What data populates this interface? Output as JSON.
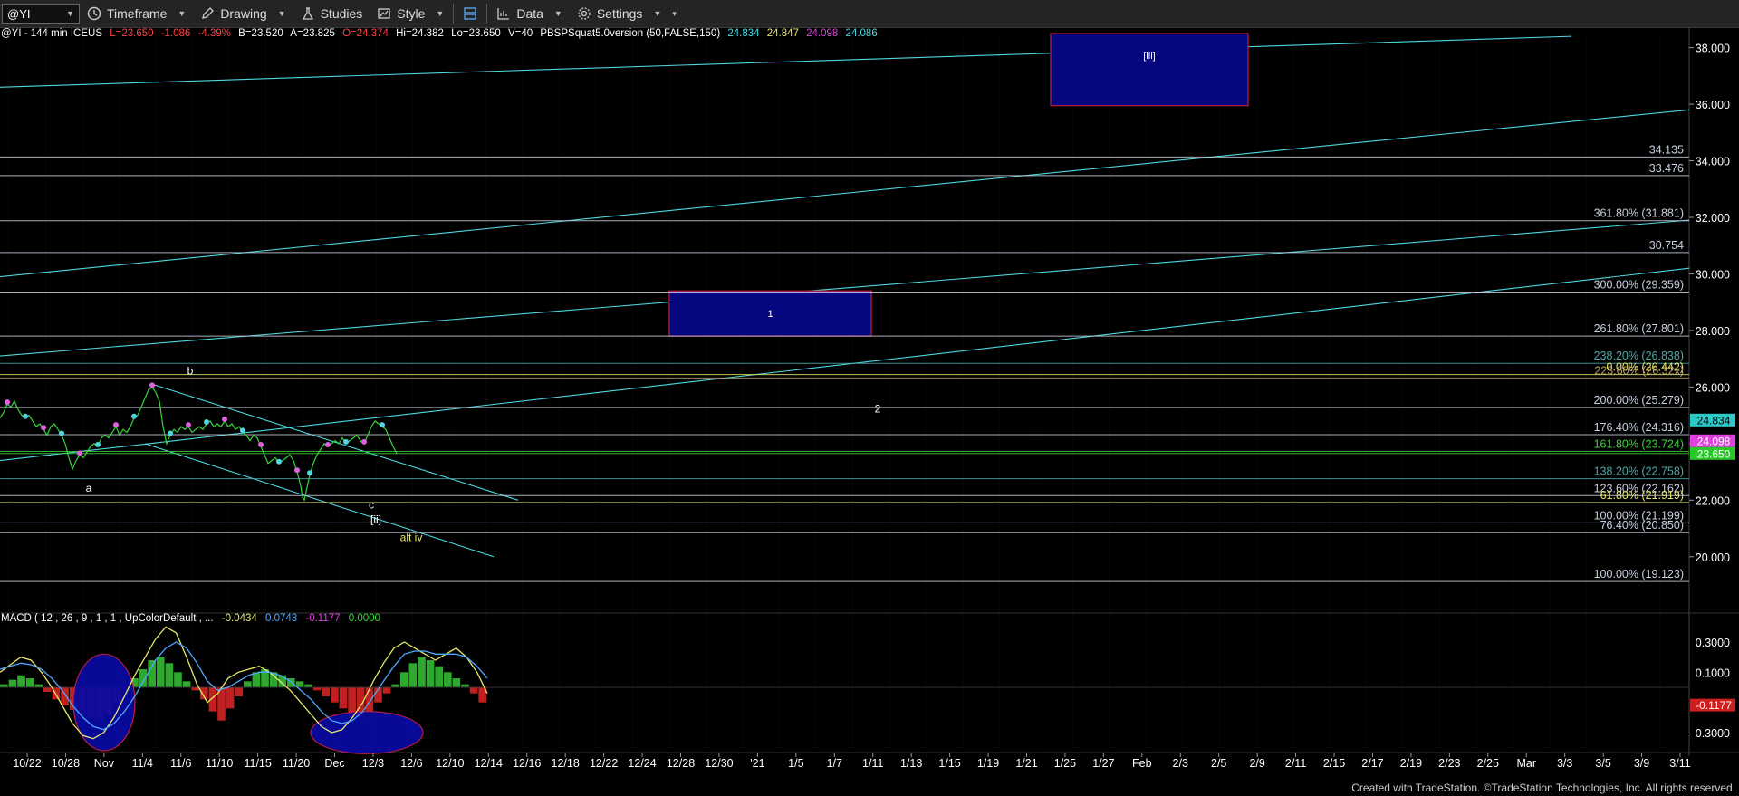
{
  "toolbar": {
    "symbol": "@YI",
    "timeframe": "Timeframe",
    "drawing": "Drawing",
    "studies": "Studies",
    "style": "Style",
    "data": "Data",
    "settings": "Settings"
  },
  "header": {
    "title": "@YI - 144 min  ICEUS",
    "last": "L=23.650",
    "change": "-1.086",
    "change_pct": "-4.39%",
    "bid": "B=23.520",
    "ask": "A=23.825",
    "open": "O=24.374",
    "high": "Hi=24.382",
    "low": "Lo=23.650",
    "volume": "V=40",
    "study": "PBSPSquat5.0version (50,FALSE,150)",
    "study_values": [
      "24.834",
      "24.847",
      "24.098",
      "24.086"
    ],
    "study_colors": [
      "#4fd7e0",
      "#e8e86a",
      "#e040e0",
      "#4fd7e0"
    ]
  },
  "macd_header": {
    "label": "MACD ( 12 , 26 , 9 , 1 , 1 , UpColorDefault , ...",
    "values": [
      "-0.0434",
      "0.0743",
      "-0.1177",
      "0.0000"
    ],
    "colors": [
      "#e8e86a",
      "#4fa8ff",
      "#e040e0",
      "#3ad43a"
    ]
  },
  "chart_data": {
    "type": "line",
    "title": "@YI - 144 min",
    "price_axis": {
      "ylim": [
        18.2,
        38.5
      ],
      "ticks": [
        "38.000",
        "36.000",
        "34.000",
        "32.000",
        "30.000",
        "28.000",
        "26.000",
        "24.000",
        "22.000",
        "20.000"
      ]
    },
    "macd_axis": {
      "ylim": [
        -0.42,
        0.42
      ],
      "ticks": [
        "0.3000",
        "0.1000",
        "-0.3000"
      ]
    },
    "x_labels": [
      "10/22",
      "10/28",
      "Nov",
      "11/4",
      "11/6",
      "11/10",
      "11/15",
      "11/20",
      "Dec",
      "12/3",
      "12/6",
      "12/10",
      "12/14",
      "12/16",
      "12/18",
      "12/22",
      "12/24",
      "12/28",
      "12/30",
      "'21",
      "1/5",
      "1/7",
      "1/11",
      "1/13",
      "1/15",
      "1/19",
      "1/21",
      "1/25",
      "1/27",
      "Feb",
      "2/3",
      "2/5",
      "2/9",
      "2/11",
      "2/15",
      "2/17",
      "2/19",
      "2/23",
      "2/25",
      "Mar",
      "3/3",
      "3/5",
      "3/9",
      "3/11"
    ],
    "price_series": [
      {
        "x": 0,
        "y": 24.9
      },
      {
        "x": 4,
        "y": 25.1
      },
      {
        "x": 8,
        "y": 25.4
      },
      {
        "x": 12,
        "y": 25.3
      },
      {
        "x": 16,
        "y": 25.5
      },
      {
        "x": 20,
        "y": 25.2
      },
      {
        "x": 24,
        "y": 25.0
      },
      {
        "x": 28,
        "y": 24.9
      },
      {
        "x": 32,
        "y": 25.0
      },
      {
        "x": 36,
        "y": 24.8
      },
      {
        "x": 40,
        "y": 24.6
      },
      {
        "x": 44,
        "y": 24.7
      },
      {
        "x": 48,
        "y": 24.5
      },
      {
        "x": 52,
        "y": 24.3
      },
      {
        "x": 56,
        "y": 24.6
      },
      {
        "x": 60,
        "y": 24.7
      },
      {
        "x": 64,
        "y": 24.5
      },
      {
        "x": 68,
        "y": 24.3
      },
      {
        "x": 72,
        "y": 24.0
      },
      {
        "x": 76,
        "y": 23.5
      },
      {
        "x": 80,
        "y": 23.1
      },
      {
        "x": 84,
        "y": 23.4
      },
      {
        "x": 88,
        "y": 23.6
      },
      {
        "x": 92,
        "y": 23.5
      },
      {
        "x": 96,
        "y": 23.7
      },
      {
        "x": 100,
        "y": 23.9
      },
      {
        "x": 104,
        "y": 24.0
      },
      {
        "x": 108,
        "y": 23.9
      },
      {
        "x": 112,
        "y": 24.2
      },
      {
        "x": 116,
        "y": 24.3
      },
      {
        "x": 120,
        "y": 24.2
      },
      {
        "x": 124,
        "y": 24.4
      },
      {
        "x": 128,
        "y": 24.6
      },
      {
        "x": 132,
        "y": 24.3
      },
      {
        "x": 136,
        "y": 24.5
      },
      {
        "x": 140,
        "y": 24.4
      },
      {
        "x": 144,
        "y": 24.6
      },
      {
        "x": 148,
        "y": 24.9
      },
      {
        "x": 152,
        "y": 25.0
      },
      {
        "x": 156,
        "y": 25.3
      },
      {
        "x": 160,
        "y": 25.6
      },
      {
        "x": 164,
        "y": 25.9
      },
      {
        "x": 168,
        "y": 26.0
      },
      {
        "x": 172,
        "y": 25.8
      },
      {
        "x": 176,
        "y": 25.5
      },
      {
        "x": 180,
        "y": 24.6
      },
      {
        "x": 184,
        "y": 24.0
      },
      {
        "x": 188,
        "y": 24.3
      },
      {
        "x": 192,
        "y": 24.5
      },
      {
        "x": 196,
        "y": 24.4
      },
      {
        "x": 200,
        "y": 24.6
      },
      {
        "x": 204,
        "y": 24.5
      },
      {
        "x": 208,
        "y": 24.6
      },
      {
        "x": 212,
        "y": 24.4
      },
      {
        "x": 216,
        "y": 24.5
      },
      {
        "x": 220,
        "y": 24.6
      },
      {
        "x": 224,
        "y": 24.5
      },
      {
        "x": 228,
        "y": 24.7
      },
      {
        "x": 232,
        "y": 24.8
      },
      {
        "x": 236,
        "y": 24.6
      },
      {
        "x": 240,
        "y": 24.7
      },
      {
        "x": 244,
        "y": 24.6
      },
      {
        "x": 248,
        "y": 24.8
      },
      {
        "x": 252,
        "y": 24.6
      },
      {
        "x": 256,
        "y": 24.7
      },
      {
        "x": 260,
        "y": 24.5
      },
      {
        "x": 264,
        "y": 24.6
      },
      {
        "x": 268,
        "y": 24.4
      },
      {
        "x": 272,
        "y": 24.3
      },
      {
        "x": 276,
        "y": 24.1
      },
      {
        "x": 280,
        "y": 24.3
      },
      {
        "x": 284,
        "y": 24.2
      },
      {
        "x": 288,
        "y": 23.9
      },
      {
        "x": 292,
        "y": 23.6
      },
      {
        "x": 296,
        "y": 23.3
      },
      {
        "x": 300,
        "y": 23.4
      },
      {
        "x": 304,
        "y": 23.5
      },
      {
        "x": 308,
        "y": 23.3
      },
      {
        "x": 312,
        "y": 23.4
      },
      {
        "x": 316,
        "y": 23.5
      },
      {
        "x": 320,
        "y": 23.6
      },
      {
        "x": 324,
        "y": 23.4
      },
      {
        "x": 328,
        "y": 23.0
      },
      {
        "x": 332,
        "y": 22.5
      },
      {
        "x": 334,
        "y": 22.1
      },
      {
        "x": 336,
        "y": 22.0
      },
      {
        "x": 338,
        "y": 22.3
      },
      {
        "x": 342,
        "y": 22.9
      },
      {
        "x": 346,
        "y": 23.3
      },
      {
        "x": 350,
        "y": 23.6
      },
      {
        "x": 354,
        "y": 23.8
      },
      {
        "x": 358,
        "y": 24.0
      },
      {
        "x": 362,
        "y": 23.9
      },
      {
        "x": 366,
        "y": 24.0
      },
      {
        "x": 370,
        "y": 24.1
      },
      {
        "x": 374,
        "y": 24.0
      },
      {
        "x": 378,
        "y": 24.2
      },
      {
        "x": 382,
        "y": 24.0
      },
      {
        "x": 386,
        "y": 24.1
      },
      {
        "x": 390,
        "y": 24.2
      },
      {
        "x": 394,
        "y": 24.3
      },
      {
        "x": 398,
        "y": 24.1
      },
      {
        "x": 402,
        "y": 24.0
      },
      {
        "x": 406,
        "y": 24.3
      },
      {
        "x": 410,
        "y": 24.6
      },
      {
        "x": 414,
        "y": 24.8
      },
      {
        "x": 418,
        "y": 24.7
      },
      {
        "x": 422,
        "y": 24.6
      },
      {
        "x": 426,
        "y": 24.5
      },
      {
        "x": 430,
        "y": 24.2
      },
      {
        "x": 434,
        "y": 23.9
      },
      {
        "x": 438,
        "y": 23.65
      }
    ],
    "bar_index_range": [
      0,
      1520
    ],
    "horizontal_levels": [
      {
        "value": 34.135,
        "label": "34.135",
        "color": "#c8d0e0"
      },
      {
        "value": 33.476,
        "label": "33.476",
        "color": "#c8d0e0"
      },
      {
        "value": 31.881,
        "label": "361.80% (31.881)",
        "color": "#c8d0e0"
      },
      {
        "value": 30.754,
        "label": "30.754",
        "color": "#c8d0e0"
      },
      {
        "value": 29.359,
        "label": "300.00% (29.359)",
        "color": "#c8d0e0"
      },
      {
        "value": 27.801,
        "label": "261.80% (27.801)",
        "color": "#c8d0e0"
      },
      {
        "value": 26.838,
        "label": "238.20% (26.838)",
        "color": "#4fa8a8"
      },
      {
        "value": 26.442,
        "label": "0.00% (26.442)",
        "color": "#e8e86a"
      },
      {
        "value": 26.32,
        "label": "223.60% (26.32x)",
        "color": "#b8a060"
      },
      {
        "value": 25.279,
        "label": "200.00% (25.279)",
        "color": "#c8d0e0"
      },
      {
        "value": 24.316,
        "label": "176.40% (24.316)",
        "color": "#c8d0e0"
      },
      {
        "value": 23.724,
        "label": "161.80% (23.724)",
        "color": "#3ad43a"
      },
      {
        "value": 23.65,
        "label": "",
        "color": "#3ad43a"
      },
      {
        "value": 22.758,
        "label": "138.20% (22.758)",
        "color": "#4fa8a8"
      },
      {
        "value": 22.162,
        "label": "123.60% (22.162)",
        "color": "#c8d0e0"
      },
      {
        "value": 21.919,
        "label": "61.80% (21.919)",
        "color": "#e8e86a"
      },
      {
        "value": 21.199,
        "label": "100.00% (21.199)",
        "color": "#c8d0e0"
      },
      {
        "value": 20.85,
        "label": "76.40% (20.850)",
        "color": "#c8d0e0"
      },
      {
        "value": 19.123,
        "label": "100.00% (19.123)",
        "color": "#c8d0e0"
      }
    ],
    "trend_lines": [
      {
        "x1": 0,
        "y1": 36.6,
        "x2": 1735,
        "y2": 38.4,
        "color": "#4fd7e0"
      },
      {
        "x1": 0,
        "y1": 29.9,
        "x2": 1865,
        "y2": 35.8,
        "color": "#4fd7e0"
      },
      {
        "x1": 0,
        "y1": 27.1,
        "x2": 1865,
        "y2": 31.9,
        "color": "#4fd7e0"
      },
      {
        "x1": 0,
        "y1": 23.4,
        "x2": 1865,
        "y2": 30.2,
        "color": "#4fd7e0"
      },
      {
        "x1": 168,
        "y1": 26.1,
        "x2": 572,
        "y2": 22.0,
        "color": "#4fd7e0"
      },
      {
        "x1": 160,
        "y1": 24.0,
        "x2": 545,
        "y2": 20.0,
        "color": "#4fd7e0"
      }
    ],
    "boxes": [
      {
        "x1": 1160,
        "x2": 1378,
        "y1": 35.95,
        "y2": 38.5,
        "label": "[iii]"
      },
      {
        "x1": 739,
        "x2": 962,
        "y1": 27.8,
        "y2": 29.4,
        "label": "1"
      }
    ],
    "wave_labels": [
      {
        "text": "b",
        "x": 210,
        "y": 26.45,
        "color": "#ffffff"
      },
      {
        "text": "a",
        "x": 98,
        "y": 22.3,
        "color": "#ffffff"
      },
      {
        "text": "c",
        "x": 410,
        "y": 21.7,
        "color": "#ffffff"
      },
      {
        "text": "[ii]",
        "x": 415,
        "y": 21.2,
        "color": "#ffffff"
      },
      {
        "text": "alt iv",
        "x": 454,
        "y": 20.55,
        "color": "#e8e86a"
      },
      {
        "text": "2",
        "x": 969,
        "y": 25.1,
        "color": "#ffffff"
      }
    ],
    "price_flags": [
      {
        "value": "24.834",
        "y": 24.834,
        "bg": "#2fc8c8",
        "fg": "#000"
      },
      {
        "value": "24.098",
        "y": 24.098,
        "bg": "#e040e0",
        "fg": "#fff"
      },
      {
        "value": "23.650",
        "y": 23.65,
        "bg": "#28c828",
        "fg": "#fff"
      }
    ],
    "macd_flag": {
      "value": "-0.1177",
      "y": -0.1177,
      "bg": "#cc2020",
      "fg": "#fff"
    },
    "macd_histogram": [
      0.02,
      0.05,
      0.08,
      0.06,
      0.02,
      -0.03,
      -0.08,
      -0.12,
      -0.15,
      -0.18,
      -0.2,
      -0.22,
      -0.18,
      -0.1,
      -0.02,
      0.06,
      0.12,
      0.18,
      0.2,
      0.16,
      0.1,
      0.04,
      -0.02,
      -0.08,
      -0.16,
      -0.22,
      -0.14,
      -0.06,
      0.04,
      0.1,
      0.12,
      0.1,
      0.08,
      0.06,
      0.04,
      0.02,
      -0.02,
      -0.06,
      -0.1,
      -0.14,
      -0.18,
      -0.2,
      -0.16,
      -0.1,
      -0.04,
      0.02,
      0.1,
      0.16,
      0.2,
      0.18,
      0.14,
      0.1,
      0.06,
      0.02,
      -0.04,
      -0.1
    ],
    "macd_line": [
      0.1,
      0.15,
      0.2,
      0.18,
      0.1,
      0.0,
      -0.12,
      -0.24,
      -0.32,
      -0.34,
      -0.3,
      -0.2,
      -0.06,
      0.08,
      0.2,
      0.32,
      0.4,
      0.36,
      0.2,
      0.02,
      -0.1,
      -0.04,
      0.06,
      0.1,
      0.12,
      0.14,
      0.1,
      0.04,
      -0.02,
      -0.1,
      -0.18,
      -0.26,
      -0.3,
      -0.28,
      -0.2,
      -0.1,
      0.04,
      0.16,
      0.26,
      0.3,
      0.26,
      0.22,
      0.18,
      0.22,
      0.26,
      0.2,
      0.1,
      -0.04
    ],
    "macd_signal": [
      0.12,
      0.14,
      0.16,
      0.15,
      0.12,
      0.06,
      -0.02,
      -0.12,
      -0.2,
      -0.26,
      -0.28,
      -0.24,
      -0.16,
      -0.06,
      0.06,
      0.18,
      0.26,
      0.3,
      0.26,
      0.16,
      0.04,
      -0.02,
      0.0,
      0.04,
      0.08,
      0.1,
      0.1,
      0.08,
      0.04,
      -0.02,
      -0.08,
      -0.16,
      -0.22,
      -0.24,
      -0.22,
      -0.16,
      -0.06,
      0.04,
      0.14,
      0.22,
      0.24,
      0.24,
      0.22,
      0.22,
      0.22,
      0.2,
      0.14,
      0.06
    ],
    "macd_ellipses": [
      {
        "cx_idx": 115,
        "cy": -0.1,
        "rx": 34,
        "ry": 0.32,
        "label": "oval-1"
      },
      {
        "cx_idx": 405,
        "cy": -0.3,
        "rx": 62,
        "ry": 0.14,
        "label": "oval-2"
      }
    ]
  },
  "footer": "Created with TradeStation. ©TradeStation Technologies, Inc. All rights reserved."
}
